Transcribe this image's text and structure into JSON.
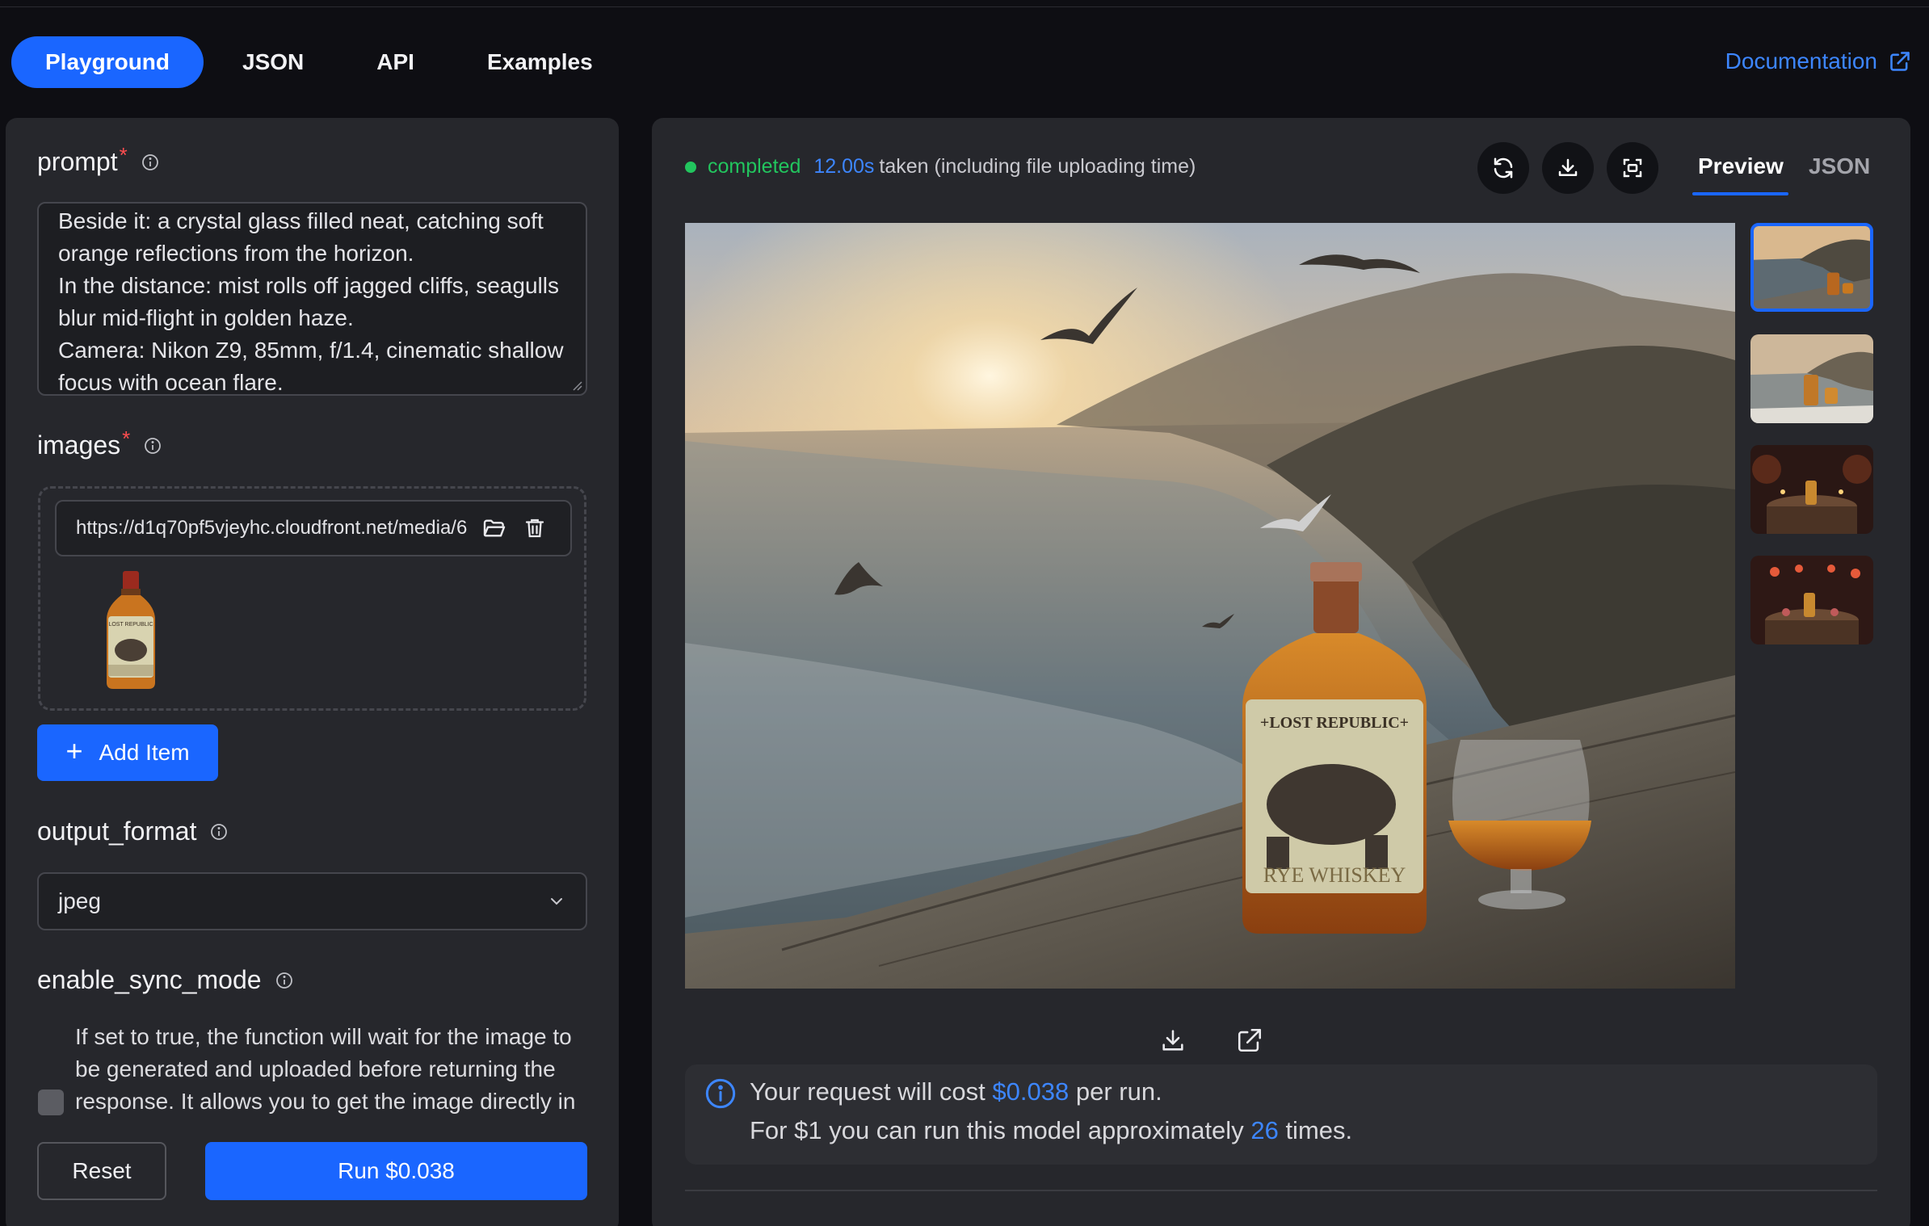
{
  "nav": {
    "tabs": [
      "Playground",
      "JSON",
      "API",
      "Examples"
    ],
    "active_tab": "Playground",
    "documentation_label": "Documentation"
  },
  "form": {
    "prompt": {
      "label": "prompt",
      "required_mark": "*",
      "lines": [
        "Beside it: a crystal glass filled neat, catching soft",
        "orange reflections from the horizon.",
        "In the distance: mist rolls off jagged cliffs, seagulls",
        "blur mid-flight in golden haze.",
        "Camera: Nikon Z9, 85mm, f/1.4, cinematic shallow",
        "focus with ocean flare."
      ]
    },
    "images": {
      "label": "images",
      "required_mark": "*",
      "url_value": "https://d1q70pf5vjeyhc.cloudfront.net/media/6",
      "add_item_label": "Add Item"
    },
    "output_format": {
      "label": "output_format",
      "selected": "jpeg"
    },
    "enable_sync_mode": {
      "label": "enable_sync_mode",
      "checked": false,
      "description": "If set to true, the function will wait for the image to be generated and uploaded before returning the response. It allows you to get the image directly in"
    },
    "reset_label": "Reset",
    "run_label": "Run $0.038"
  },
  "result": {
    "status": "completed",
    "time": "12.00s",
    "time_suffix": "taken (including file uploading time)",
    "view_tabs": [
      "Preview",
      "JSON"
    ],
    "active_view": "Preview",
    "cost": {
      "line1_prefix": "Your request will cost",
      "price": "$0.038",
      "line1_suffix": "per run.",
      "line2_prefix": "For $1 you can run this model approximately",
      "runs": "26",
      "line2_suffix": "times."
    },
    "thumbnails": [
      "cliff-sunset-bottle",
      "cliff-sunset-bottle-2",
      "barrel-candles-bottle",
      "barrel-candles-bottle-2"
    ]
  },
  "colors": {
    "accent": "#1a66ff",
    "success": "#22c55e",
    "panel": "#26272c",
    "background": "#0e0e13"
  }
}
